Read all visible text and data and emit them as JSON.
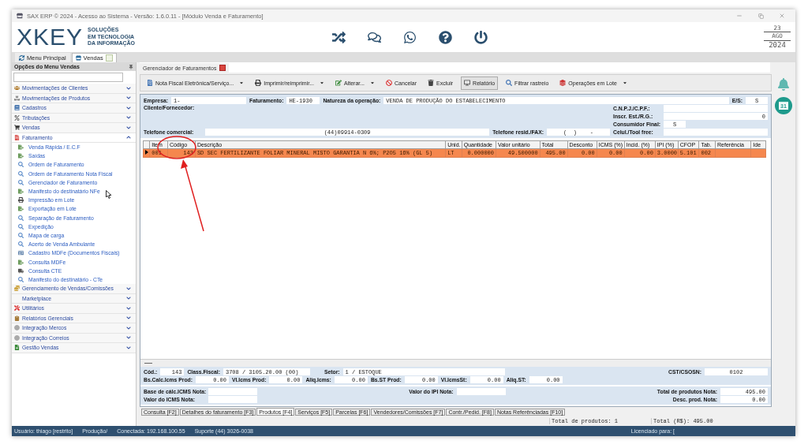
{
  "window": {
    "title": "SAX ERP © 2024 - Acesso ao Sistema - Versão: 1.6.0.11 - [Módulo Venda e Faturamento]"
  },
  "header": {
    "logo": "XKEY",
    "tagline": [
      "SOLUÇÕES",
      "EM TECNOLOGIA",
      "DA INFORMAÇÃO"
    ],
    "date": {
      "day": "23",
      "month": "AGO",
      "year": "2024"
    }
  },
  "module_tabs": [
    {
      "label": "Menu Principal",
      "selected": false
    },
    {
      "label": "Vendas",
      "selected": true
    }
  ],
  "sidebar": {
    "title": "Opções do Menu Vendas",
    "groups": [
      {
        "label": "Movimentações de Clientes",
        "kind": "people",
        "expanded": false
      },
      {
        "label": "Movimentações de Produtos",
        "kind": "boxes",
        "expanded": false
      },
      {
        "label": "Cadastros",
        "kind": "book",
        "expanded": false
      },
      {
        "label": "Tributações",
        "kind": "percent",
        "expanded": false
      },
      {
        "label": "Vendas",
        "kind": "cart",
        "expanded": false
      },
      {
        "label": "Faturamento",
        "kind": "invoice",
        "expanded": true,
        "children": [
          {
            "label": "Venda Rápida / E.C.F",
            "kind": "document"
          },
          {
            "label": "Saídas",
            "kind": "document"
          },
          {
            "label": "Ordem de Faturamento",
            "kind": "search"
          },
          {
            "label": "Ordem de Faturamento Nota Fiscal",
            "kind": "search"
          },
          {
            "label": "Gerenciador de Faturamento",
            "kind": "search"
          },
          {
            "label": "Manifesto do destinatário NFe",
            "kind": "document"
          },
          {
            "label": "Impressão em Lote",
            "kind": "printer"
          },
          {
            "label": "Exportação em Lote",
            "kind": "document"
          },
          {
            "label": "Separação de Faturamento",
            "kind": "search"
          },
          {
            "label": "Expedição",
            "kind": "search"
          },
          {
            "label": "Mapa de carga",
            "kind": "search"
          },
          {
            "label": "Acerto de Venda Ambulante",
            "kind": "search"
          },
          {
            "label": "Cadastro MDFe (Documentos Fiscais)",
            "kind": "card"
          },
          {
            "label": "Consulta MDFe",
            "kind": "document"
          },
          {
            "label": "Consulta CTE",
            "kind": "truck"
          },
          {
            "label": "Manifesto do destinatário - CTe",
            "kind": "search"
          }
        ]
      },
      {
        "label": "Gerenciamento de Vendas/Comissões",
        "kind": "coins",
        "expanded": false
      },
      {
        "label": "Marketplace",
        "kind": "none",
        "expanded": false
      },
      {
        "label": "Utilitários",
        "kind": "tools",
        "expanded": false
      },
      {
        "label": "Relatórios Gerenciais",
        "kind": "clipboard",
        "expanded": false
      },
      {
        "label": "Integração Mercos",
        "kind": "circle",
        "expanded": false
      },
      {
        "label": "Integração Correios",
        "kind": "circle",
        "expanded": false
      },
      {
        "label": "Gestão Vendas",
        "kind": "sheet",
        "expanded": false
      }
    ]
  },
  "document_tab": {
    "label": "Gerenciador de Faturamentos"
  },
  "toolbar": [
    {
      "label": "Nota Fiscal Eletrônica/Serviço...",
      "kind": "nfe",
      "dropdown": true,
      "selected": false
    },
    {
      "label": "Imprimir/reimprimir...",
      "kind": "print",
      "dropdown": true,
      "selected": false
    },
    {
      "label": "Alterar...",
      "kind": "edit",
      "dropdown": true,
      "selected": false
    },
    {
      "label": "Cancelar",
      "kind": "cancel",
      "dropdown": false,
      "selected": false
    },
    {
      "label": "Excluir",
      "kind": "delete",
      "dropdown": false,
      "selected": false
    },
    {
      "label": "Relatório",
      "kind": "report",
      "dropdown": false,
      "selected": true
    },
    {
      "label": "Filtrar rastreio",
      "kind": "filter",
      "dropdown": false,
      "selected": false
    },
    {
      "label": "Operações em Lote",
      "kind": "batch",
      "dropdown": true,
      "selected": false
    }
  ],
  "form": {
    "empresa": {
      "label": "Empresa:",
      "value": "1-"
    },
    "faturamento": {
      "label": "Faturamento:",
      "value": "HE-1930"
    },
    "natureza": {
      "label": "Natureza da operação:",
      "value": "VENDA DE PRODUÇÃO DO ESTABELECIMENTO"
    },
    "es": {
      "label": "E/S:",
      "value": "S"
    },
    "cliente": {
      "label": "Cliente/Fornecedor:"
    },
    "cnpj": {
      "label": "C.N.P.J./C.P.F.:"
    },
    "inscr": {
      "label": "Inscr. Est./R.G.:",
      "value": "0"
    },
    "consumidor": {
      "label": "Consumidor Final:",
      "value": "S"
    },
    "tel_comercial": {
      "label": "Telefone comercial:",
      "value": "(44)09914-0309"
    },
    "tel_resid": {
      "label": "Telefone resid./FAX:",
      "value": "(  )    -"
    },
    "celular": {
      "label": "Celul./Tool free:"
    }
  },
  "grid": {
    "columns": [
      "Item",
      "Código",
      "Descrição",
      "Unid.",
      "Quantidade",
      "Valor unitário",
      "Total",
      "Desconto",
      "ICMS (%)",
      "Incid. (%)",
      "IPI (%)",
      "CFOP",
      "Tab.",
      "Referência",
      "Ide"
    ],
    "rows": [
      {
        "selected": true,
        "cells": [
          "001",
          "143",
          "SD SEC FERTILIZANTE FOLIAR MINERAL MISTO GARANTIA N 6%; P2O5 16% (GL 5)",
          "LT",
          "0.000000",
          "49.500000",
          "495.00",
          "0.00",
          "0.00",
          "0.00",
          "3.0000",
          "5.101",
          "002",
          "",
          ""
        ]
      }
    ]
  },
  "detail": {
    "product": [
      {
        "label": "Cód.:",
        "value": "143"
      },
      {
        "label": "Class.Fiscal:",
        "value": "3708 / 3105.20.00 (00)"
      },
      {
        "label": "Setor:",
        "value": "1 / ESTOQUE"
      }
    ],
    "cst": {
      "label": "CST/CSOSN:",
      "value": "0102"
    },
    "taxes": [
      {
        "label": "Bs.Calc.Icms Prod:",
        "value": "0.00"
      },
      {
        "label": "Vl.Icms Prod:",
        "value": "0.00"
      },
      {
        "label": "Aliq.Icms:",
        "value": "0.00"
      },
      {
        "label": "Bs.ST Prod:",
        "value": "0.00"
      },
      {
        "label": "Vl.IcmsSt:",
        "value": "0.00"
      },
      {
        "label": "Aliq.ST:",
        "value": "0.00"
      }
    ]
  },
  "totals": {
    "left": [
      {
        "label": "Base de cálc.ICMS Nota:"
      },
      {
        "label": "Valor do ICMS Nota:"
      }
    ],
    "middle": {
      "label": "Valor do IPI Nota:"
    },
    "right": [
      {
        "label": "Total de produtos Nota:",
        "value": "495.00"
      },
      {
        "label": "Desc. prod. Nota:",
        "value": "0.00"
      }
    ]
  },
  "bottom_tabs": [
    {
      "label": "Consulta [F2]",
      "selected": false
    },
    {
      "label": "Detalhes do faturamento [F3]",
      "selected": false
    },
    {
      "label": "Produtos [F4]",
      "selected": true
    },
    {
      "label": "Serviços [F5]",
      "selected": false
    },
    {
      "label": "Parcelas [F6]",
      "selected": false
    },
    {
      "label": "Vendedores/Comissões [F7]",
      "selected": false
    },
    {
      "label": "Contr./Pedid. [F8]",
      "selected": false
    },
    {
      "label": "Notas Referênciadas [F10]",
      "selected": false
    }
  ],
  "summary": [
    "Total de produtos: 1",
    "Total (R$): 495.00"
  ],
  "side_widgets": {
    "calendar_day": "31"
  },
  "status_bar": {
    "left": [
      "Usuário: thiago [restrito]",
      "Produção/",
      "Conectada: 192.168.100.55",
      "Suporte (44) 3026-0038"
    ],
    "right": "Licenciado para: ["
  }
}
